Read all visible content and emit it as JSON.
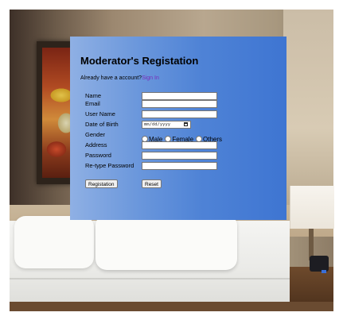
{
  "form": {
    "title": "Moderator's Registation",
    "account_prompt": "Already have a account?",
    "signin_link": "Sign In",
    "fields": {
      "name": {
        "label": "Name",
        "value": ""
      },
      "email": {
        "label": "Email",
        "value": ""
      },
      "username": {
        "label": "User Name",
        "value": ""
      },
      "dob": {
        "label": "Date of Birth",
        "placeholder": "mm/dd/yyyy"
      },
      "gender": {
        "label": "Gender",
        "options": [
          "Male",
          "Female",
          "Others"
        ]
      },
      "address": {
        "label": "Address",
        "value": ""
      },
      "password": {
        "label": "Password",
        "value": ""
      },
      "retype_password": {
        "label": "Re-type Password",
        "value": ""
      }
    },
    "buttons": {
      "submit": "Registation",
      "reset": "Reset"
    }
  },
  "colors": {
    "panel_left": "#8fb0e4",
    "panel_right": "#3e75d2",
    "link": "#7a2bb8"
  },
  "icons": {
    "date_picker": "calendar-icon",
    "radio": "radio-button-icon"
  }
}
